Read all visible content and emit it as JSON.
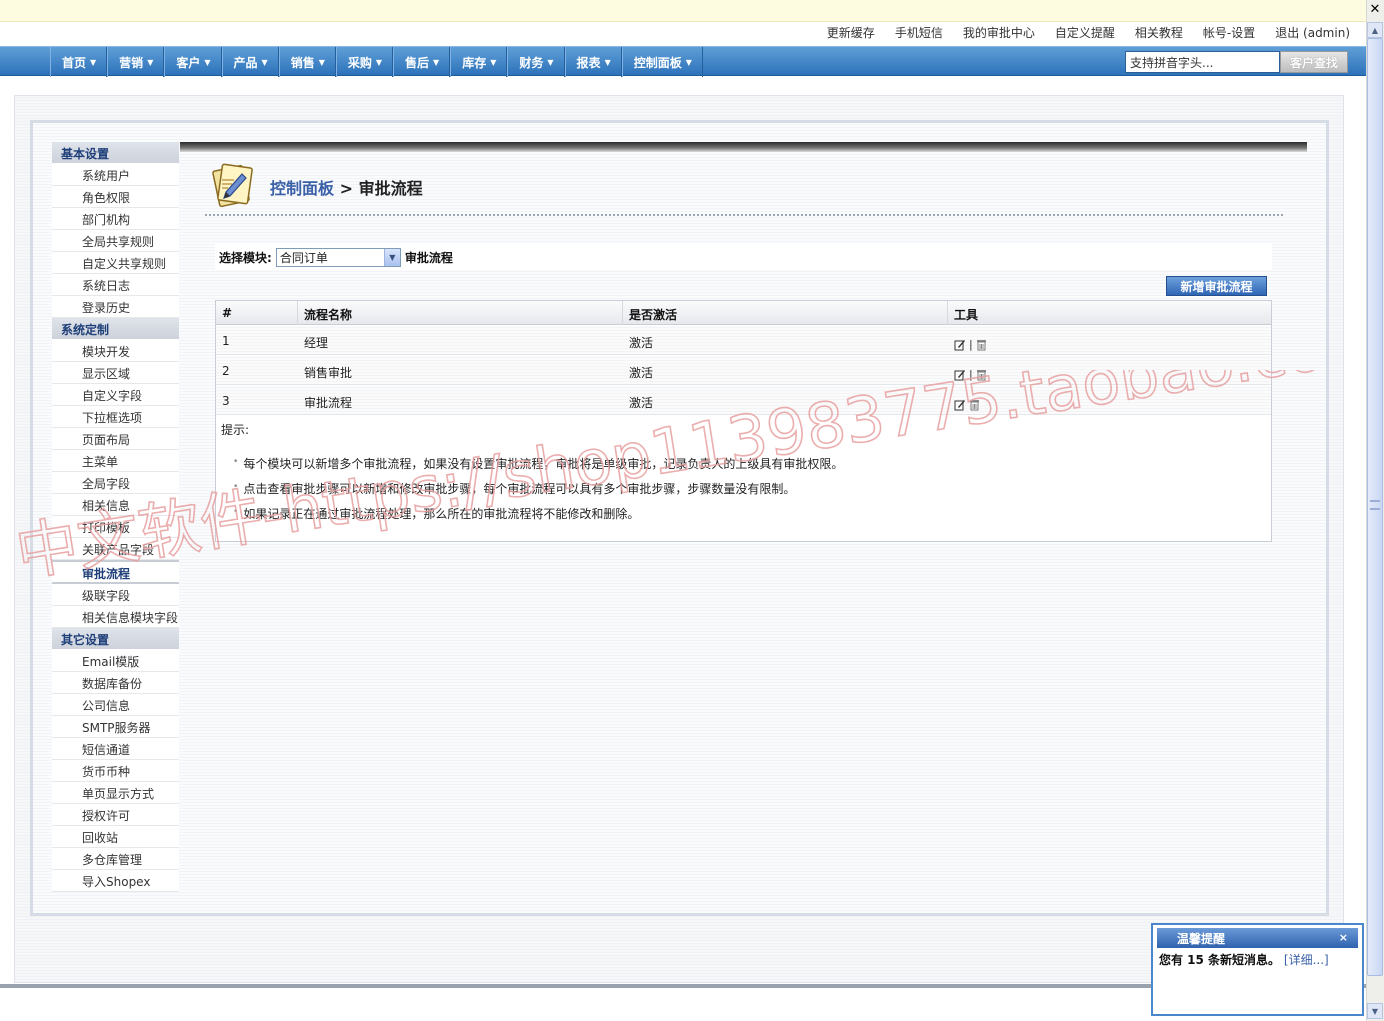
{
  "toplinks": [
    "更新缓存",
    "手机短信",
    "我的审批中心",
    "自定义提醒",
    "相关教程",
    "帐号-设置",
    "退出 (admin)"
  ],
  "nav": {
    "items": [
      "首页",
      "营销",
      "客户",
      "产品",
      "销售",
      "采购",
      "售后",
      "库存",
      "财务",
      "报表",
      "控制面板"
    ],
    "search_placeholder": "支持拼音字头...",
    "search_button": "客户查找"
  },
  "sidebar": {
    "groups": [
      {
        "title": "基本设置",
        "items": [
          "系统用户",
          "角色权限",
          "部门机构",
          "全局共享规则",
          "自定义共享规则",
          "系统日志",
          "登录历史"
        ]
      },
      {
        "title": "系统定制",
        "items": [
          "模块开发",
          "显示区域",
          "自定义字段",
          "下拉框选项",
          "页面布局",
          "主菜单",
          "全局字段",
          "相关信息",
          "打印模板",
          "关联产品字段",
          "审批流程",
          "级联字段",
          "相关信息模块字段"
        ],
        "active": "审批流程"
      },
      {
        "title": "其它设置",
        "items": [
          "Email模版",
          "数据库备份",
          "公司信息",
          "SMTP服务器",
          "短信通道",
          "货币币种",
          "单页显示方式",
          "授权许可",
          "回收站",
          "多仓库管理",
          "导入Shopex"
        ]
      }
    ]
  },
  "page": {
    "crumb": "控制面板",
    "separator": " > ",
    "title": "审批流程"
  },
  "selector": {
    "label": "选择模块:",
    "value": "合同订单",
    "suffix": "审批流程"
  },
  "new_button": "新增审批流程",
  "table": {
    "headers": [
      "#",
      "流程名称",
      "是否激活",
      "工具"
    ],
    "rows": [
      {
        "num": "1",
        "name": "经理",
        "active": "激活"
      },
      {
        "num": "2",
        "name": "销售审批",
        "active": "激活"
      },
      {
        "num": "3",
        "name": "审批流程",
        "active": "激活"
      }
    ],
    "tool_separator": "|"
  },
  "tips": {
    "title": "提示:",
    "items": [
      "每个模块可以新增多个审批流程，如果没有设置审批流程，审批将是单级审批，记录负责人的上级具有审批权限。",
      "点击查看审批步骤可以新增和修改审批步骤，每个审批流程可以具有多个审批步骤，步骤数量没有限制。",
      "如果记录正在通过审批流程处理，那么所在的审批流程将不能修改和删除。"
    ]
  },
  "notify": {
    "title": "温馨提醒",
    "close": "×",
    "text_prefix": "您有 15 条新短消息。",
    "detail": "[详细...]"
  },
  "watermark": "中文软件-https://shop113983775.taobao.com",
  "colors": {
    "nav_blue": "#2d73bb",
    "link_blue": "#3a61a8",
    "watermark_red": "#e8a0a0"
  }
}
